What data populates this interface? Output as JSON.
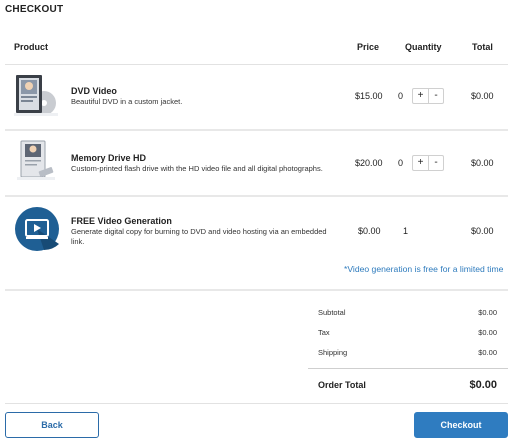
{
  "page": {
    "title": "CHECKOUT"
  },
  "table": {
    "headers": {
      "product": "Product",
      "price": "Price",
      "quantity": "Quantity",
      "total": "Total"
    },
    "items": [
      {
        "name": "DVD Video",
        "description": "Beautiful DVD in a custom jacket.",
        "price": "$15.00",
        "quantity": "0",
        "total": "$0.00",
        "icon": "dvd-case-icon",
        "plus": "+",
        "minus": "-"
      },
      {
        "name": "Memory Drive HD",
        "description": "Custom-printed flash drive with the HD video file and all digital photographs.",
        "price": "$20.00",
        "quantity": "0",
        "total": "$0.00",
        "icon": "flash-drive-icon",
        "plus": "+",
        "minus": "-"
      },
      {
        "name": "FREE Video Generation",
        "description": "Generate digital copy for burning to DVD and video hosting via an embedded link.",
        "price": "$0.00",
        "quantity": "1",
        "total": "$0.00",
        "icon": "video-play-icon"
      }
    ]
  },
  "promo_note": "*Video generation is free for a limited time",
  "summary": {
    "subtotal_label": "Subtotal",
    "subtotal": "$0.00",
    "tax_label": "Tax",
    "tax": "$0.00",
    "shipping_label": "Shipping",
    "shipping": "$0.00",
    "order_total_label": "Order Total",
    "order_total": "$0.00"
  },
  "buttons": {
    "back": "Back",
    "checkout": "Checkout"
  },
  "colors": {
    "accent": "#2f7cc0",
    "promo": "#2e7bbd",
    "circle": "#1f5f94"
  }
}
